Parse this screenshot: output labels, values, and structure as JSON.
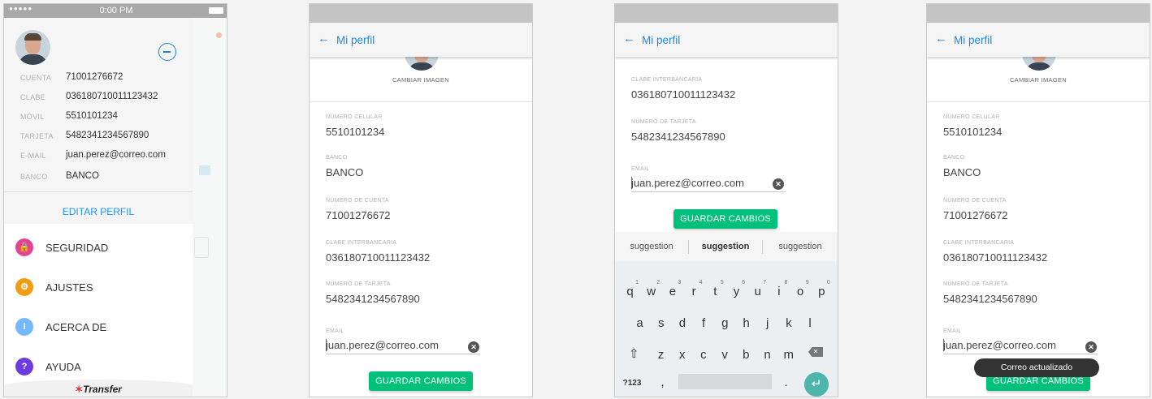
{
  "drawer": {
    "status_time": "0:00 PM",
    "rows": [
      {
        "label": "CUENTA",
        "value": "71001276672"
      },
      {
        "label": "CLABE",
        "value": "036180710011123432"
      },
      {
        "label": "MÓVIL",
        "value": "5510101234"
      },
      {
        "label": "TARJETA",
        "value": "5482341234567890"
      },
      {
        "label": "E-MAIL",
        "value": "juan.perez@correo.com"
      },
      {
        "label": "BANCO",
        "value": "BANCO"
      }
    ],
    "edit_profile": "EDITAR PERFIL",
    "menu": [
      {
        "label": "SEGURIDAD",
        "color": "#e84393",
        "icon": "lock-icon"
      },
      {
        "label": "AJUSTES",
        "color": "#f39c12",
        "icon": "gear-icon"
      },
      {
        "label": "ACERCA DE",
        "color": "#74b9ff",
        "icon": "info-icon"
      },
      {
        "label": "AYUDA",
        "color": "#6c3ce0",
        "icon": "question-icon"
      }
    ],
    "brand": "Transfer"
  },
  "profile": {
    "title": "Mi perfil",
    "change_image": "CAMBIAR IMAGEN",
    "fields": [
      {
        "label": "NÚMERO CELULAR",
        "value": "5510101234"
      },
      {
        "label": "BANCO",
        "value": "BANCO"
      },
      {
        "label": "NÚMERO DE CUENTA",
        "value": "71001276672"
      },
      {
        "label": "CLABE INTERBANCARIA",
        "value": "036180710011123432"
      },
      {
        "label": "NÚMERO DE TARJETA",
        "value": "5482341234567890"
      }
    ],
    "email_label": "EMAIL",
    "email_value": "juan.perez@correo.com",
    "save_button": "GUARDAR CAMBIOS",
    "toast": "Correo actualizado"
  },
  "keyboard": {
    "suggestions": [
      "suggestion",
      "suggestion",
      "suggestion"
    ],
    "row1": [
      "q",
      "w",
      "e",
      "r",
      "t",
      "y",
      "u",
      "i",
      "o",
      "p"
    ],
    "row1_numbers": [
      "1",
      "2",
      "3",
      "4",
      "5",
      "6",
      "7",
      "8",
      "9",
      "0"
    ],
    "row2": [
      "a",
      "s",
      "d",
      "f",
      "g",
      "h",
      "j",
      "k",
      "l"
    ],
    "row3": [
      "z",
      "x",
      "c",
      "v",
      "b",
      "n",
      "m"
    ],
    "symbols_key": "?123",
    "comma_key": ",",
    "period_key": "."
  },
  "colors": {
    "accent": "#1e88e5",
    "save": "#00c07a"
  }
}
